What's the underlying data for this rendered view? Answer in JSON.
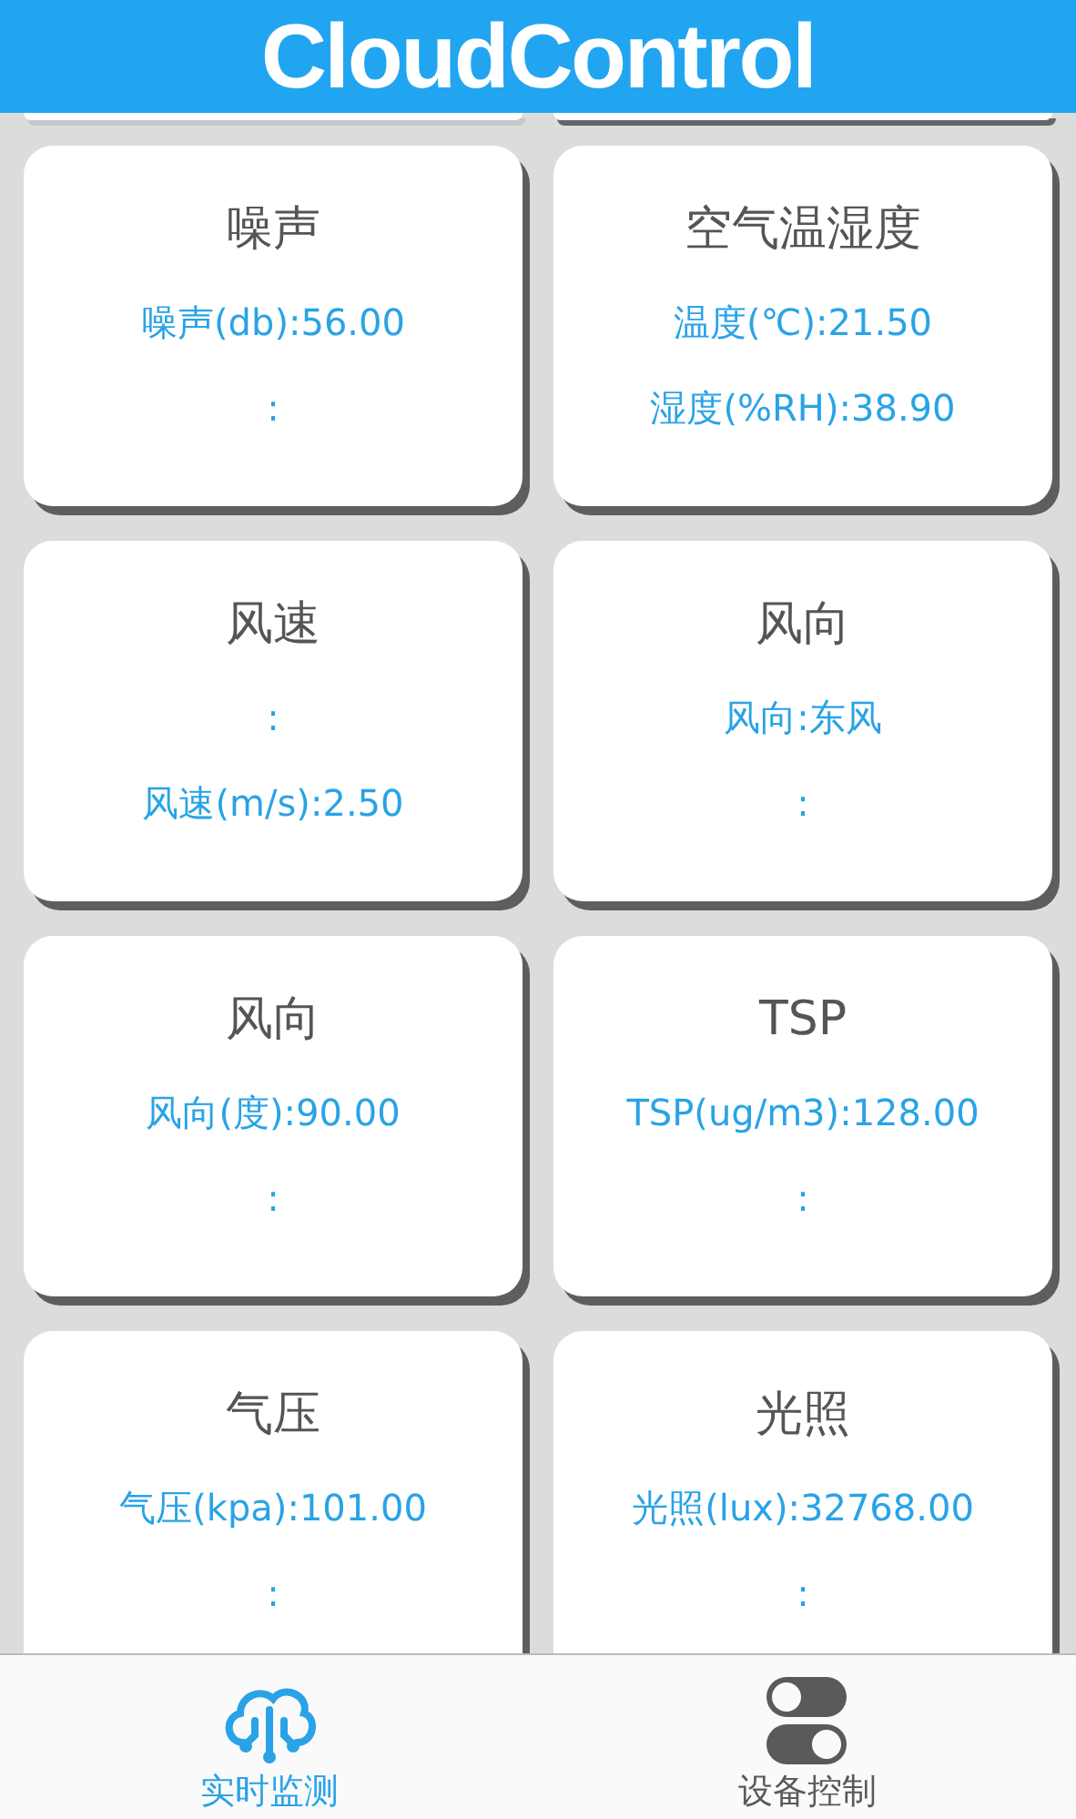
{
  "header": {
    "title": "CloudControl"
  },
  "cards": [
    {
      "title": "噪声",
      "lines": [
        "噪声(db):56.00",
        ":"
      ]
    },
    {
      "title": "空气温湿度",
      "lines": [
        "温度(℃):21.50",
        "湿度(%RH):38.90"
      ]
    },
    {
      "title": "风速",
      "lines": [
        ":",
        "风速(m/s):2.50"
      ]
    },
    {
      "title": "风向",
      "lines": [
        "风向:东风",
        ":"
      ]
    },
    {
      "title": "风向",
      "lines": [
        "风向(度):90.00",
        ":"
      ]
    },
    {
      "title": "TSP",
      "lines": [
        "TSP(ug/m3):128.00",
        ":"
      ]
    },
    {
      "title": "气压",
      "lines": [
        "气压(kpa):101.00",
        ":"
      ]
    },
    {
      "title": "光照",
      "lines": [
        "光照(lux):32768.00",
        ":"
      ]
    }
  ],
  "tabs": [
    {
      "label": "实时监测",
      "kind": "cloud",
      "selected": true
    },
    {
      "label": "设备控制",
      "kind": "toggles",
      "selected": false
    }
  ]
}
